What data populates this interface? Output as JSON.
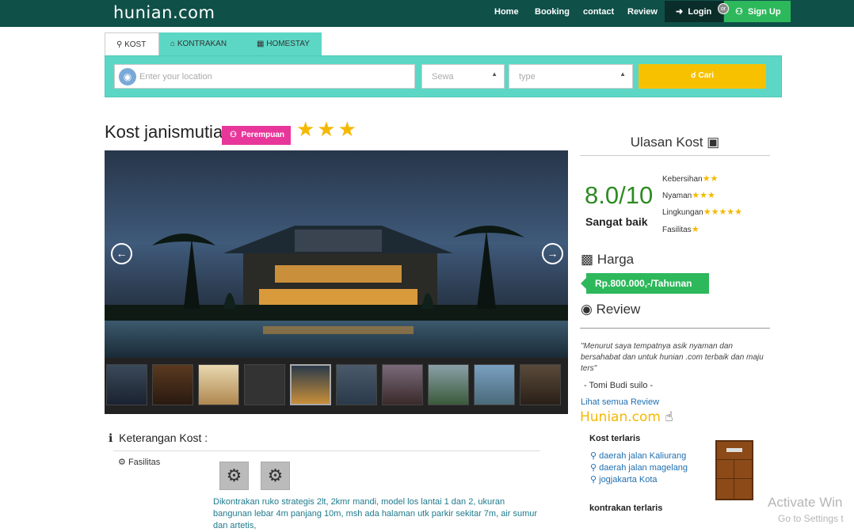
{
  "brand": "hunian.com",
  "nav": {
    "home": "Home",
    "booking": "Booking",
    "contact": "contact",
    "review": "Review",
    "login": "Login",
    "or": "or",
    "signup": "Sign Up"
  },
  "tabs": [
    {
      "label": "KOST",
      "icon": "key-icon"
    },
    {
      "label": "KONTRAKAN",
      "icon": "home-icon"
    },
    {
      "label": "HOMESTAY",
      "icon": "building-icon"
    }
  ],
  "search": {
    "location_placeholder": "Enter your location",
    "sewa": "Sewa",
    "type": "type",
    "button": "Cari"
  },
  "listing": {
    "title": "Kost janismutia",
    "badge": "Perempuan",
    "rating_stars": 3
  },
  "info": {
    "title": "Keterangan Kost :",
    "fasilitas": "Fasilitas",
    "description": "Dikontrakan ruko strategis 2lt, 2kmr mandi, model los lantai 1 dan 2, ukuran bangunan lebar 4m panjang 10m, msh ada halaman utk parkir sekitar 7m, air sumur dan artetis,"
  },
  "review": {
    "heading": "Ulasan Kost",
    "score": "8.0/10",
    "score_label": "Sangat baik",
    "criteria": [
      {
        "label": "Kebersihan",
        "stars": "★★"
      },
      {
        "label": "Nyaman",
        "stars": "★★★"
      },
      {
        "label": "Lingkungan",
        "stars": "★★★★★"
      },
      {
        "label": "Fasilitas",
        "stars": "★"
      }
    ],
    "price_heading": "Harga",
    "price": "Rp.800.000,-/Tahunan",
    "review_heading": "Review",
    "quote": "\"Menurut saya tempatnya asik nyaman dan bersahabat dan untuk hunian .com terbaik dan maju ters\"",
    "author": "- Tomi Budi suilo -",
    "see_all": "Lihat semua Review"
  },
  "sidebar": {
    "logo": "Hunian.com",
    "kost_terlaris": "Kost terlaris",
    "locations": [
      "daerah jalan Kaliurang",
      "daerah jalan magelang",
      "jogjakarta Kota"
    ],
    "kontrakan_terlaris": "kontrakan terlaris"
  },
  "watermark": {
    "line1": "Activate Win",
    "line2": "Go to Settings t"
  },
  "colors": {
    "nav": "#0f5048",
    "search_bar": "#5dd7c5",
    "accent": "#f7c100",
    "green": "#2eb85c",
    "pink": "#e8379a"
  }
}
